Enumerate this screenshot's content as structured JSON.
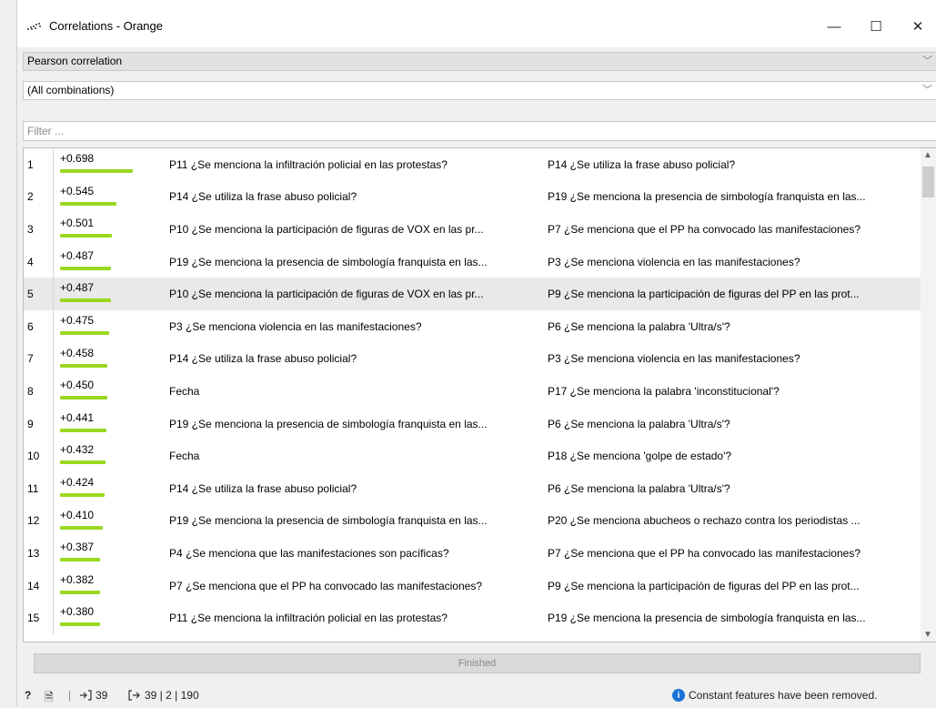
{
  "window": {
    "title": "Correlations - Orange",
    "minimize_label": "—",
    "maximize_label": "☐",
    "close_label": "✕"
  },
  "controls": {
    "method": "Pearson correlation",
    "feature": "(All combinations)",
    "filter_placeholder": "Filter ..."
  },
  "table": {
    "rows": [
      {
        "idx": "1",
        "score": "+0.698",
        "value": 0.698,
        "a": "P11 ¿Se menciona la infiltración policial en las protestas?",
        "b": "P14 ¿Se utiliza la frase abuso policial?"
      },
      {
        "idx": "2",
        "score": "+0.545",
        "value": 0.545,
        "a": "P14 ¿Se utiliza la frase abuso policial?",
        "b": "P19 ¿Se menciona la presencia de simbología franquista en las..."
      },
      {
        "idx": "3",
        "score": "+0.501",
        "value": 0.501,
        "a": "P10 ¿Se menciona la participación de figuras de VOX en las pr...",
        "b": "P7 ¿Se menciona que el PP ha convocado las manifestaciones?"
      },
      {
        "idx": "4",
        "score": "+0.487",
        "value": 0.487,
        "a": "P19 ¿Se menciona la presencia de simbología franquista en las...",
        "b": "P3 ¿Se menciona violencia en las manifestaciones?"
      },
      {
        "idx": "5",
        "score": "+0.487",
        "value": 0.487,
        "a": "P10 ¿Se menciona la participación de figuras de VOX en las pr...",
        "b": "P9 ¿Se menciona la participación de figuras del PP en las prot..."
      },
      {
        "idx": "6",
        "score": "+0.475",
        "value": 0.475,
        "a": "P3 ¿Se menciona violencia en las manifestaciones?",
        "b": "P6 ¿Se menciona la palabra 'Ultra/s'?"
      },
      {
        "idx": "7",
        "score": "+0.458",
        "value": 0.458,
        "a": "P14 ¿Se utiliza la frase abuso policial?",
        "b": "P3 ¿Se menciona violencia en las manifestaciones?"
      },
      {
        "idx": "8",
        "score": "+0.450",
        "value": 0.45,
        "a": "Fecha",
        "b": "P17 ¿Se menciona la palabra 'inconstitucional'?"
      },
      {
        "idx": "9",
        "score": "+0.441",
        "value": 0.441,
        "a": "P19 ¿Se menciona la presencia de simbología franquista en las...",
        "b": "P6 ¿Se menciona la palabra 'Ultra/s'?"
      },
      {
        "idx": "10",
        "score": "+0.432",
        "value": 0.432,
        "a": "Fecha",
        "b": "P18 ¿Se menciona 'golpe de estado'?"
      },
      {
        "idx": "11",
        "score": "+0.424",
        "value": 0.424,
        "a": "P14 ¿Se utiliza la frase abuso policial?",
        "b": "P6 ¿Se menciona la palabra 'Ultra/s'?"
      },
      {
        "idx": "12",
        "score": "+0.410",
        "value": 0.41,
        "a": "P19 ¿Se menciona la presencia de simbología franquista en las...",
        "b": "P20 ¿Se menciona abucheos o rechazo contra los periodistas ..."
      },
      {
        "idx": "13",
        "score": "+0.387",
        "value": 0.387,
        "a": "P4 ¿Se menciona que las manifestaciones son pacíficas?",
        "b": "P7 ¿Se menciona que el PP ha convocado las manifestaciones?"
      },
      {
        "idx": "14",
        "score": "+0.382",
        "value": 0.382,
        "a": "P7 ¿Se menciona que el PP ha convocado las manifestaciones?",
        "b": "P9 ¿Se menciona la participación de figuras del PP en las prot..."
      },
      {
        "idx": "15",
        "score": "+0.380",
        "value": 0.38,
        "a": "P11 ¿Se menciona la infiltración policial en las protestas?",
        "b": "P19 ¿Se menciona la presencia de simbología franquista en las..."
      }
    ],
    "selected_index": 4,
    "bar_color": "#9ad820"
  },
  "progress": {
    "label": "Finished"
  },
  "status": {
    "help_icon": "?",
    "report_icon": "🗎",
    "separator": "|",
    "input_count": "39",
    "output_summary": "39 | 2 | 190",
    "message": "Constant features have been removed.",
    "info_icon": "i"
  }
}
